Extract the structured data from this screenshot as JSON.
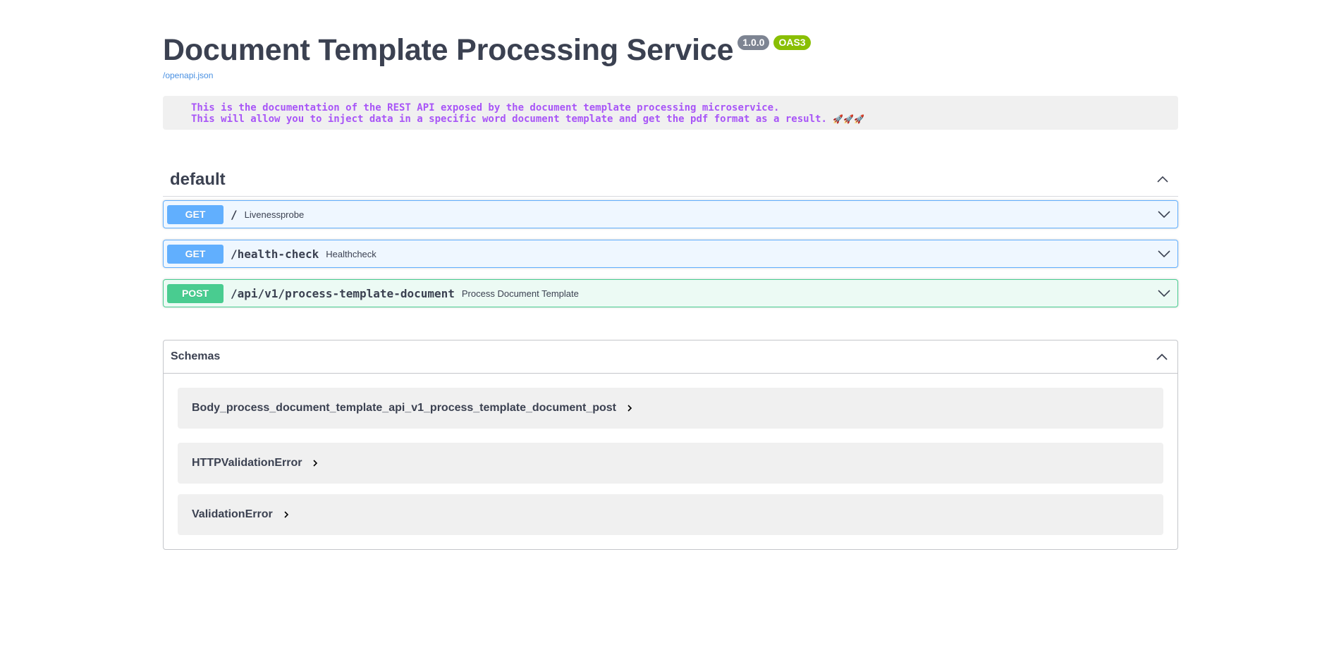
{
  "info": {
    "title": "Document Template Processing Service",
    "version": "1.0.0",
    "oas": "OAS3",
    "spec_link": "/openapi.json",
    "description_lines": [
      "This is the documentation of the REST API exposed by the document template processing microservice.",
      "This will allow you to inject data in a specific word document template and get the pdf format as a result."
    ],
    "rockets": "🚀🚀🚀"
  },
  "tag": {
    "name": "default",
    "operations": [
      {
        "method": "GET",
        "path": "/",
        "summary": "Livenessprobe"
      },
      {
        "method": "GET",
        "path": "/health-check",
        "summary": "Healthcheck"
      },
      {
        "method": "POST",
        "path": "/api/v1/process-template-document",
        "summary": "Process Document Template"
      }
    ]
  },
  "schemas": {
    "title": "Schemas",
    "items": [
      "Body_process_document_template_api_v1_process_template_document_post",
      "HTTPValidationError",
      "ValidationError"
    ]
  },
  "icons": {
    "collapse": "chevron-up-icon",
    "expand": "chevron-down-icon",
    "model_expand": "chevron-right-icon"
  },
  "colors": {
    "get": "#61affe",
    "post": "#49cc90",
    "version_badge": "#7d8492",
    "oas_badge": "#89bf04",
    "description_text": "#a855f7",
    "link": "#4990e2"
  }
}
